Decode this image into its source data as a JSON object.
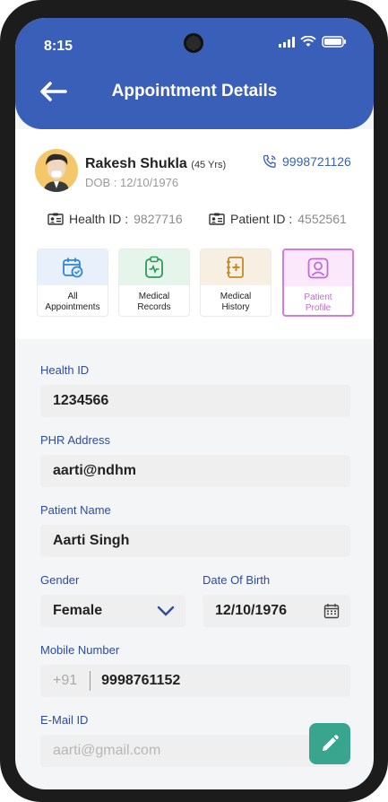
{
  "status": {
    "time": "8:15"
  },
  "header": {
    "title": "Appointment Details"
  },
  "patient": {
    "name": "Rakesh Shukla",
    "age": "(45 Yrs)",
    "dob_label": "DOB :",
    "dob": "12/10/1976",
    "phone": "9998721126",
    "health_id_label": "Health ID :",
    "health_id": "9827716",
    "patient_id_label": "Patient ID :",
    "patient_id": "4552561"
  },
  "tiles": [
    {
      "label_line1": "All",
      "label_line2": "Appointments",
      "icon": "calendar-check-icon",
      "bg": "#e8f1fb",
      "color": "#2f86d9"
    },
    {
      "label_line1": "Medical",
      "label_line2": "Records",
      "icon": "clipboard-pulse-icon",
      "bg": "#e6f5ec",
      "color": "#2c9a57"
    },
    {
      "label_line1": "Medical",
      "label_line2": "History",
      "icon": "medical-book-icon",
      "bg": "#f7efe2",
      "color": "#c38a27"
    },
    {
      "label_line1": "Patient",
      "label_line2": "Profile",
      "icon": "user-profile-icon",
      "bg": "#fbe9fb",
      "color": "#c06bd6"
    }
  ],
  "form": {
    "health_id_label": "Health ID",
    "health_id_value": "1234566",
    "phr_label": "PHR Address",
    "phr_value": "aarti@ndhm",
    "patient_name_label": "Patient Name",
    "patient_name_value": "Aarti Singh",
    "gender_label": "Gender",
    "gender_value": "Female",
    "dob_label": "Date Of Birth",
    "dob_value": "12/10/1976",
    "mobile_label": "Mobile Number",
    "mobile_prefix": "+91",
    "mobile_value": "9998761152",
    "email_label": "E-Mail ID",
    "email_value": "aarti@gmail.com"
  },
  "colors": {
    "header": "#3a5fb8",
    "accent": "#2f4b9a",
    "fab": "#3aa58e",
    "active": "#d27ae6"
  }
}
